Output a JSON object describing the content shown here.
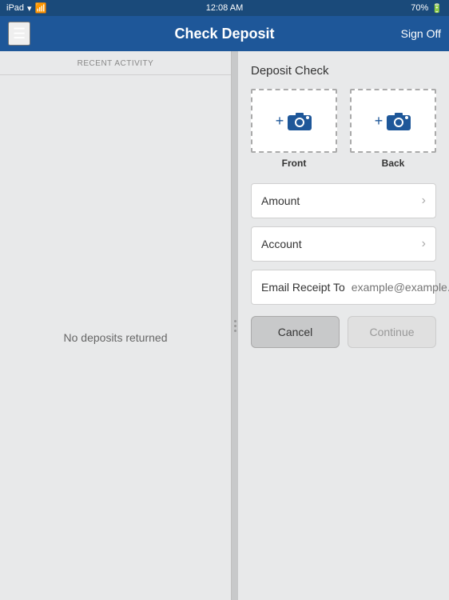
{
  "statusBar": {
    "device": "iPad",
    "wifi": "wifi",
    "time": "12:08 AM",
    "battery": "70%"
  },
  "navBar": {
    "menuIcon": "☰",
    "title": "Check Deposit",
    "signOff": "Sign Off"
  },
  "sidebar": {
    "header": "RECENT ACTIVITY",
    "emptyMessage": "No deposits returned"
  },
  "rightPanel": {
    "sectionTitle": "Deposit Check",
    "frontLabel": "Front",
    "backLabel": "Back",
    "plusSymbol": "+",
    "amountLabel": "Amount",
    "accountLabel": "Account",
    "emailReceiptLabel": "Email Receipt To",
    "emailPlaceholder": "example@example.com",
    "cancelButton": "Cancel",
    "continueButton": "Continue"
  }
}
